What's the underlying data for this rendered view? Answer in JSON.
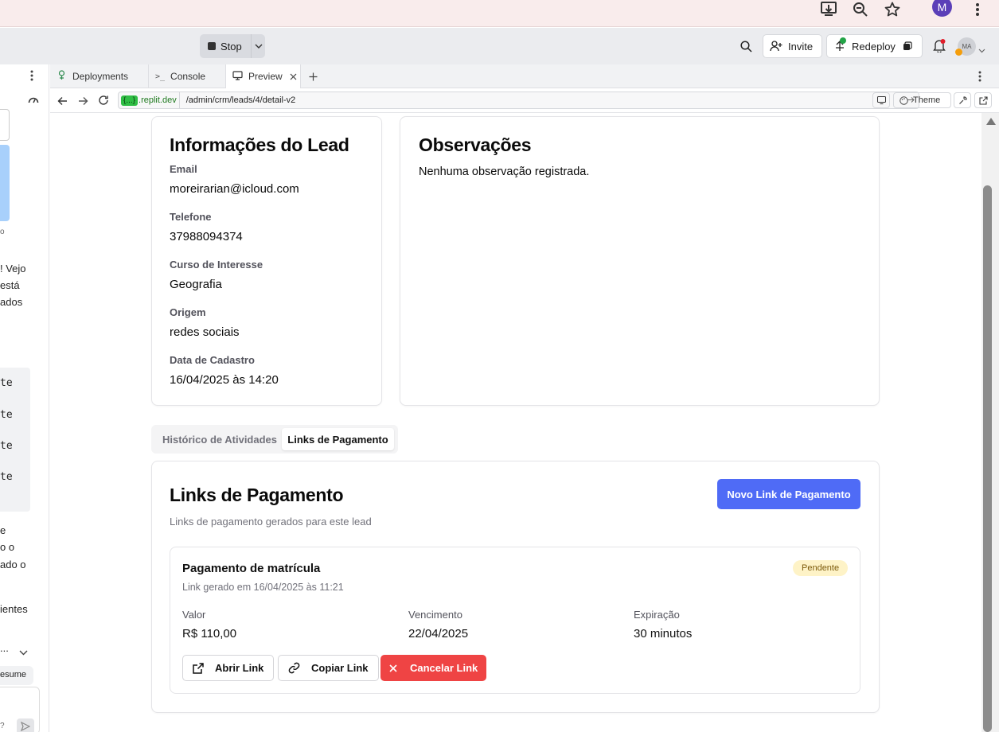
{
  "browser": {
    "profile_initial": "M",
    "icons": [
      "install-icon",
      "zoom-icon",
      "star-icon",
      "more-icon"
    ]
  },
  "toolbar": {
    "stop_label": "Stop",
    "invite_label": "Invite",
    "redeploy_label": "Redeploy",
    "avatar_initials": "MA"
  },
  "tabs": [
    {
      "label": "Deployments"
    },
    {
      "label": "Console"
    },
    {
      "label": "Preview"
    }
  ],
  "address": {
    "badge": "{...}",
    "domain": ".replit.dev",
    "path": "/admin/crm/leads/4/detail-v2",
    "theme_label": "Theme"
  },
  "left_panel": {
    "snippets": [
      "o",
      "! Vejo",
      "está",
      "ados",
      "te",
      "te",
      "te",
      "te",
      "e",
      "o o",
      "ado o",
      "ientes",
      "...",
      "esume",
      "?"
    ]
  },
  "lead_info": {
    "title": "Informações do Lead",
    "fields": [
      {
        "label": "Email",
        "value": "moreirarian@icloud.com"
      },
      {
        "label": "Telefone",
        "value": "37988094374"
      },
      {
        "label": "Curso de Interesse",
        "value": "Geografia"
      },
      {
        "label": "Origem",
        "value": "redes sociais"
      },
      {
        "label": "Data de Cadastro",
        "value": "16/04/2025 às 14:20"
      }
    ]
  },
  "notes": {
    "title": "Observações",
    "text": "Nenhuma observação registrada."
  },
  "section_tabs": [
    {
      "label": "Histórico de Atividades",
      "active": false
    },
    {
      "label": "Links de Pagamento",
      "active": true
    }
  ],
  "payment_links": {
    "title": "Links de Pagamento",
    "subtitle": "Links de pagamento gerados para este lead",
    "new_button": "Novo Link de Pagamento",
    "item": {
      "title": "Pagamento de matrícula",
      "generated": "Link gerado em 16/04/2025 às 11:21",
      "status": "Pendente",
      "status_color": "#fef3c7",
      "details": [
        {
          "label": "Valor",
          "value": "R$ 110,00"
        },
        {
          "label": "Vencimento",
          "value": "22/04/2025"
        },
        {
          "label": "Expiração",
          "value": "30 minutos"
        }
      ],
      "actions": {
        "open": "Abrir Link",
        "copy": "Copiar Link",
        "cancel": "Cancelar Link"
      }
    }
  },
  "colors": {
    "primary": "#4f6bf6",
    "danger": "#ef4444"
  }
}
